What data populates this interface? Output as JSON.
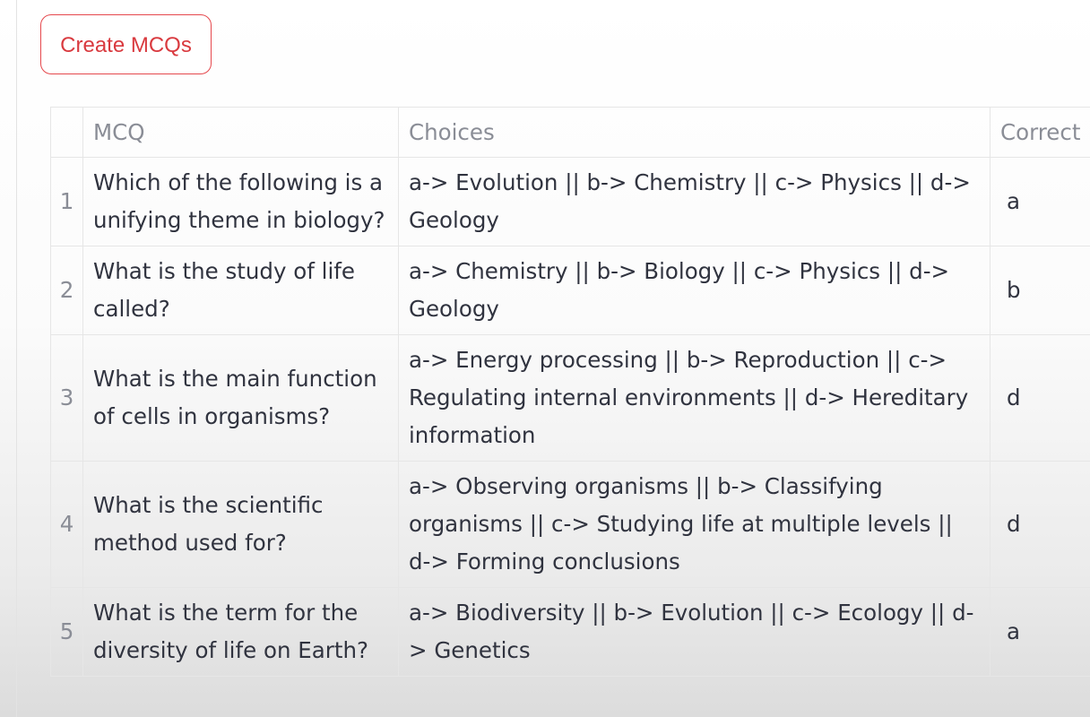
{
  "button": {
    "label": "Create MCQs"
  },
  "table": {
    "headers": [
      "",
      "MCQ",
      "Choices",
      "Correct"
    ],
    "rows": [
      {
        "index": "1",
        "mcq": "Which of the following is a unifying theme in biology?",
        "choices": "a-> Evolution || b-> Chemistry || c-> Physics || d-> Geology",
        "correct": "a"
      },
      {
        "index": "2",
        "mcq": "What is the study of life called?",
        "choices": "a-> Chemistry || b-> Biology || c-> Physics || d-> Geology",
        "correct": "b"
      },
      {
        "index": "3",
        "mcq": "What is the main function of cells in organisms?",
        "choices": "a-> Energy processing || b-> Reproduction || c-> Regulating internal environments || d-> Hereditary information",
        "correct": "d"
      },
      {
        "index": "4",
        "mcq": "What is the scientific method used for?",
        "choices": "a-> Observing organisms || b-> Classifying organisms || c-> Studying life at multiple levels || d-> Forming conclusions",
        "correct": "d"
      },
      {
        "index": "5",
        "mcq": "What is the term for the diversity of life on Earth?",
        "choices": "a-> Biodiversity || b-> Evolution || c-> Ecology || d-> Genetics",
        "correct": "a"
      }
    ]
  },
  "colors": {
    "button_accent": "#e5484d",
    "text": "#30333f",
    "muted_text": "#8a8d96",
    "grid_line": "#e6e6e6"
  }
}
